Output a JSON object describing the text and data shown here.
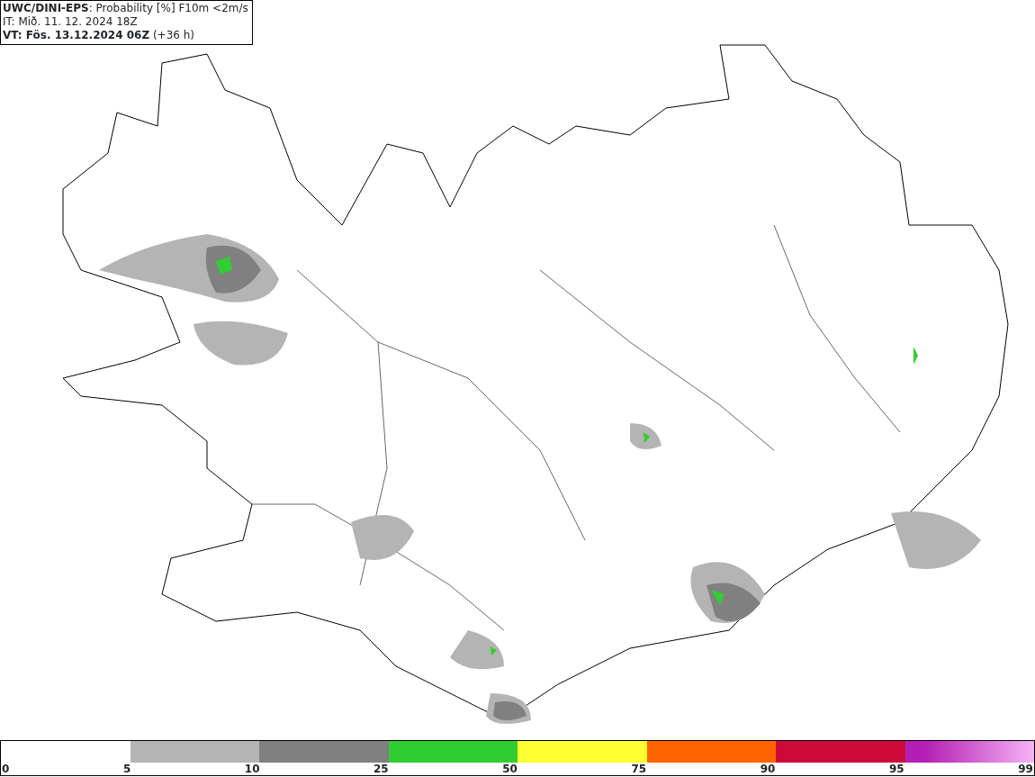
{
  "header": {
    "lines": [
      "**UWC/DINI-EPS**: Probability [%] F10m <2m/s",
      "IT: Mið. 11. 12. 2024 18Z",
      "**VT: Fös. 13.12.2024 06Z** (+36 h)"
    ]
  },
  "legend": {
    "segments": [
      {
        "color": "#b4b4b4"
      },
      {
        "color": "#808080"
      },
      {
        "color": "#32cd32"
      },
      {
        "color": "#ffff32"
      },
      {
        "color": "#ff6400"
      },
      {
        "color": "#cd0a37"
      },
      {
        "color": "#b41eb4",
        "kind": "gradient"
      }
    ],
    "labels": [
      "0",
      "5",
      "10",
      "25",
      "50",
      "75",
      "90",
      "95",
      "99"
    ]
  }
}
